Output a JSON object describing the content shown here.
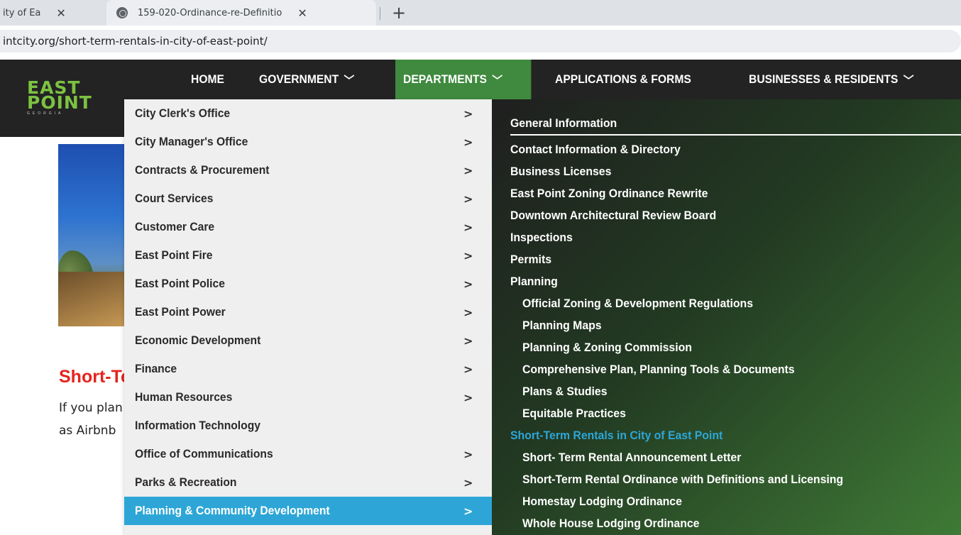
{
  "browser": {
    "tabs": [
      {
        "title": "ity of Ea",
        "close": "✕"
      },
      {
        "title": "159-020-Ordinance-re-Definitio",
        "close": "✕"
      }
    ],
    "new_tab": "+",
    "url": "intcity.org/short-term-rentals-in-city-of-east-point/"
  },
  "site": {
    "logo": {
      "line1": "EAST",
      "line2": "POINT",
      "line3": "GEORGIA"
    },
    "nav": [
      {
        "label": "HOME",
        "chevron": ""
      },
      {
        "label": "GOVERNMENT",
        "chevron": "﹀"
      },
      {
        "label": "DEPARTMENTS",
        "chevron": "﹀"
      },
      {
        "label": "APPLICATIONS & FORMS",
        "chevron": ""
      },
      {
        "label": "BUSINESSES & RESIDENTS",
        "chevron": "﹀"
      }
    ],
    "page_title": "Short-Term Rentals",
    "body_lines": [
      "If you plan",
      "as Airbnb"
    ]
  },
  "departments_menu": {
    "arrow": ">",
    "items": [
      {
        "label": "City Clerk's Office",
        "arrow": ">"
      },
      {
        "label": "City Manager's Office",
        "arrow": ">"
      },
      {
        "label": "Contracts & Procurement",
        "arrow": ">"
      },
      {
        "label": "Court Services",
        "arrow": ">"
      },
      {
        "label": "Customer Care",
        "arrow": ">"
      },
      {
        "label": "East Point Fire",
        "arrow": ">"
      },
      {
        "label": "East Point Police",
        "arrow": ">"
      },
      {
        "label": "East Point Power",
        "arrow": ">"
      },
      {
        "label": "Economic Development",
        "arrow": ">"
      },
      {
        "label": "Finance",
        "arrow": ">"
      },
      {
        "label": "Human Resources",
        "arrow": ">"
      },
      {
        "label": "Information Technology",
        "arrow": ""
      },
      {
        "label": "Office of Communications",
        "arrow": ">"
      },
      {
        "label": "Parks & Recreation",
        "arrow": ">"
      },
      {
        "label": "Planning & Community Development",
        "arrow": ">"
      }
    ]
  },
  "planning_submenu": {
    "items": [
      {
        "label": "General Information"
      },
      {
        "label": "Contact Information & Directory"
      },
      {
        "label": "Business Licenses"
      },
      {
        "label": "East Point Zoning Ordinance Rewrite"
      },
      {
        "label": "Downtown Architectural Review Board"
      },
      {
        "label": "Inspections"
      },
      {
        "label": "Permits"
      },
      {
        "label": "Planning"
      },
      {
        "label": "Official Zoning & Development Regulations"
      },
      {
        "label": "Planning Maps"
      },
      {
        "label": "Planning & Zoning Commission"
      },
      {
        "label": "Comprehensive Plan, Planning Tools & Documents"
      },
      {
        "label": "Plans & Studies"
      },
      {
        "label": "Equitable Practices"
      },
      {
        "label": "Short-Term Rentals in City of East Point"
      },
      {
        "label": "Short- Term Rental Announcement Letter"
      },
      {
        "label": "Short-Term Rental Ordinance with Definitions and Licensing"
      },
      {
        "label": "Homestay Lodging Ordinance"
      },
      {
        "label": "Whole House Lodging Ordinance"
      }
    ]
  },
  "colors": {
    "header_bg": "#232323",
    "nav_active": "#3f8a3e",
    "menu_highlight": "#2da6d7",
    "title_red": "#e6231e",
    "logo_green": "#7cc242"
  }
}
